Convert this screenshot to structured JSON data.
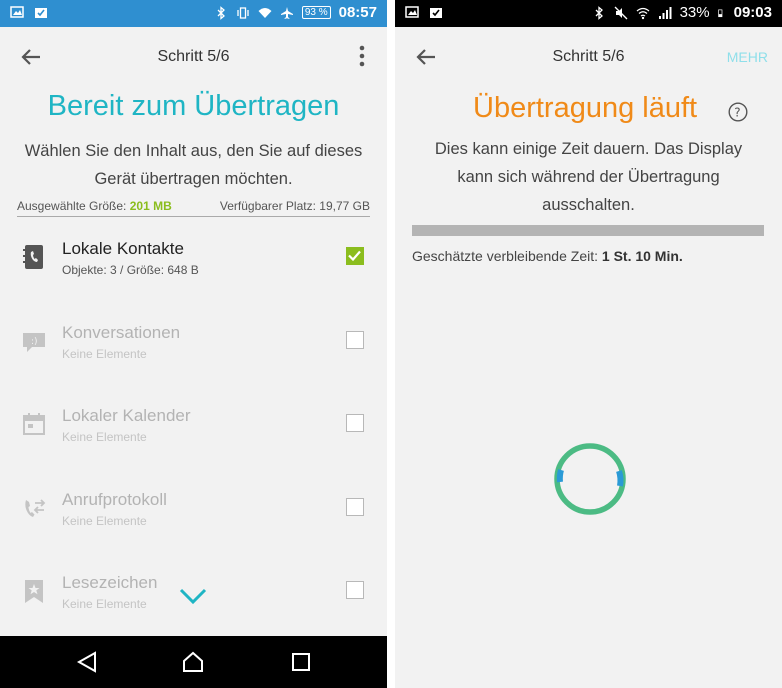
{
  "left": {
    "status": {
      "battery": "93 %",
      "time": "08:57"
    },
    "step": "Schritt 5/6",
    "title": "Bereit zum Übertragen",
    "desc_line1": "Wählen Sie den Inhalt aus, den Sie auf dieses",
    "desc_line2": "Gerät übertragen möchten.",
    "selected_size_label": "Ausgewählte Größe:",
    "selected_size_value": "201 MB",
    "available_label": "Verfügbarer Platz:",
    "available_value": "19,77 GB",
    "items": [
      {
        "name": "Lokale Kontakte",
        "sub": "Objekte: 3 / Größe: 648 B",
        "checked": true,
        "icon": "contacts-icon"
      },
      {
        "name": "Konversationen",
        "sub": "Keine Elemente",
        "checked": false,
        "icon": "conversation-icon"
      },
      {
        "name": "Lokaler Kalender",
        "sub": "Keine Elemente",
        "checked": false,
        "icon": "calendar-icon"
      },
      {
        "name": "Anrufprotokoll",
        "sub": "Keine Elemente",
        "checked": false,
        "icon": "call-log-icon"
      },
      {
        "name": "Lesezeichen",
        "sub": "Keine Elemente",
        "checked": false,
        "icon": "bookmark-icon"
      }
    ],
    "colors": {
      "accent": "#1fb5c4",
      "statusbar": "#2f8fd0",
      "check": "#8bbd1e"
    }
  },
  "right": {
    "status": {
      "battery": "33%",
      "time": "09:03"
    },
    "step": "Schritt 5/6",
    "more_label": "MEHR",
    "title": "Übertragung läuft",
    "desc_line1": "Dies kann einige Zeit dauern. Das Display",
    "desc_line2": "kann sich während der Übertragung",
    "desc_line3": "ausschalten.",
    "eta_label": "Geschätzte verbleibende Zeit:",
    "eta_value": "1 St. 10 Min.",
    "progress": 0,
    "colors": {
      "title": "#f08a18",
      "spinner": "#4cbb84",
      "spinner_accent": "#2a9ad6"
    }
  }
}
